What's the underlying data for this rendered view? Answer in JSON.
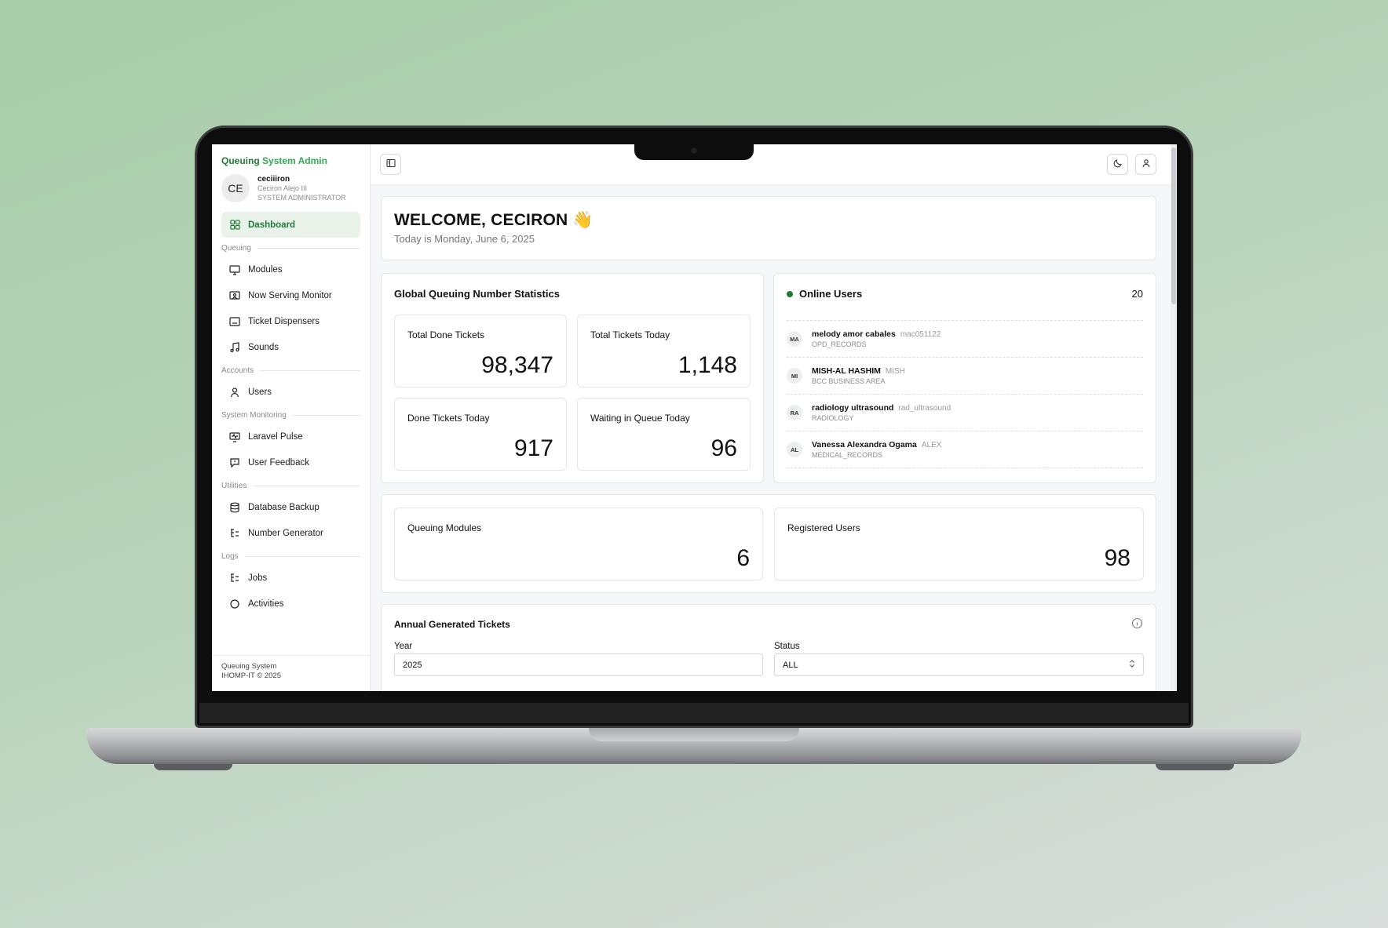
{
  "brand": {
    "part1": "Queuing",
    "part2": "System Admin"
  },
  "user": {
    "initials": "CE",
    "username": "ceciiiron",
    "full_name": "Ceciron Alejo III",
    "role": "SYSTEM ADMINISTRATOR"
  },
  "sidebar": {
    "dashboard": "Dashboard",
    "sections": {
      "queuing": "Queuing",
      "accounts": "Accounts",
      "monitoring": "System Monitoring",
      "utilities": "Utilities",
      "logs": "Logs"
    },
    "items": {
      "modules": "Modules",
      "now_serving": "Now Serving Monitor",
      "dispensers": "Ticket Dispensers",
      "sounds": "Sounds",
      "users": "Users",
      "pulse": "Laravel Pulse",
      "feedback": "User Feedback",
      "backup": "Database Backup",
      "number_generator": "Number Generator",
      "jobs": "Jobs",
      "activities": "Activities"
    },
    "footer": {
      "line1": "Queuing System",
      "line2": "IHOMP-IT © 2025"
    }
  },
  "welcome": {
    "title": "WELCOME, CECIRON",
    "emoji": "👋",
    "date": "Today is Monday, June 6, 2025"
  },
  "stats": {
    "title": "Global Queuing Number Statistics",
    "total_done_label": "Total Done Tickets",
    "total_done_value": "98,347",
    "total_today_label": "Total Tickets Today",
    "total_today_value": "1,148",
    "done_today_label": "Done Tickets Today",
    "done_today_value": "917",
    "waiting_label": "Waiting in Queue Today",
    "waiting_value": "96"
  },
  "online": {
    "title": "Online Users",
    "count": "20",
    "users": [
      {
        "initials": "MA",
        "name": "melody amor cabales",
        "handle": "mac051122",
        "dept": "OPD_RECORDS"
      },
      {
        "initials": "MI",
        "name": "MISH-AL HASHIM",
        "handle": "MISH",
        "dept": "BCC BUSINESS AREA"
      },
      {
        "initials": "RA",
        "name": "radiology ultrasound",
        "handle": "rad_ultrasound",
        "dept": "RADIOLOGY"
      },
      {
        "initials": "AL",
        "name": "Vanessa Alexandra Ogama",
        "handle": "ALEX",
        "dept": "MEDICAL_RECORDS"
      }
    ]
  },
  "summary": {
    "modules_label": "Queuing Modules",
    "modules_value": "6",
    "users_label": "Registered Users",
    "users_value": "98"
  },
  "annual": {
    "title": "Annual Generated Tickets",
    "year_label": "Year",
    "year_value": "2025",
    "status_label": "Status",
    "status_value": "ALL"
  },
  "colors": {
    "accent": "#1f7a36",
    "accent_light": "#e9f3ea"
  }
}
